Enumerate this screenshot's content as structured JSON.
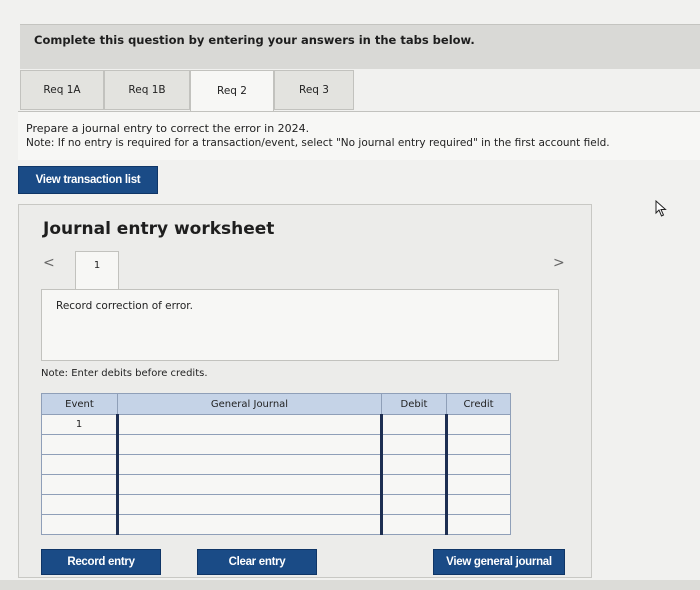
{
  "instruction": "Complete this question by entering your answers in the tabs below.",
  "tabs": [
    {
      "label": "Req 1A"
    },
    {
      "label": "Req 1B"
    },
    {
      "label": "Req 2"
    },
    {
      "label": "Req 3"
    }
  ],
  "active_tab": "Req 2",
  "prompt": {
    "line1": "Prepare a journal entry to correct the error in 2024.",
    "line2": "Note: If no entry is required for a transaction/event, select \"No journal entry required\" in the first account field."
  },
  "view_transaction_list": "View transaction list",
  "worksheet": {
    "title": "Journal entry worksheet",
    "nav_left": "<",
    "nav_right": ">",
    "tab_label": "1",
    "panel_text": "Record correction of error.",
    "note": "Note: Enter debits before credits.",
    "table": {
      "headers": [
        "Event",
        "General Journal",
        "Debit",
        "Credit"
      ],
      "rows": [
        {
          "event": "1",
          "account": "",
          "debit": "",
          "credit": ""
        },
        {
          "event": "",
          "account": "",
          "debit": "",
          "credit": ""
        },
        {
          "event": "",
          "account": "",
          "debit": "",
          "credit": ""
        },
        {
          "event": "",
          "account": "",
          "debit": "",
          "credit": ""
        },
        {
          "event": "",
          "account": "",
          "debit": "",
          "credit": ""
        },
        {
          "event": "",
          "account": "",
          "debit": "",
          "credit": ""
        }
      ]
    }
  },
  "buttons": {
    "record_entry": "Record entry",
    "clear_entry": "Clear entry",
    "view_general_journal": "View general journal"
  },
  "colors": {
    "button_blue": "#1a4b86",
    "table_header": "#c5d3e7"
  }
}
